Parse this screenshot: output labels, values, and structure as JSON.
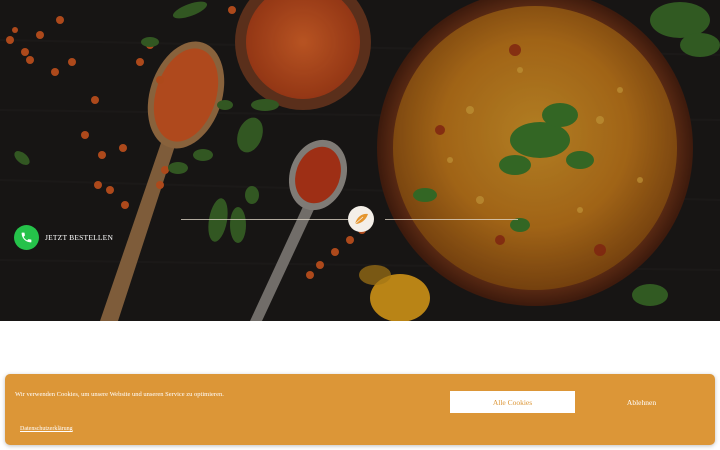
{
  "hero": {
    "image_description": "dark wooden table with lentil soup bowl, red lentils, spices and herbs",
    "emblem_icon": "leaf-emblem-icon"
  },
  "order_button": {
    "label": "JETZT BESTELLEN",
    "icon": "phone-icon",
    "color": "#25c24a"
  },
  "cookie_banner": {
    "message": "Wir verwenden Cookies, um unsere Website und unseren Service zu optimieren.",
    "accept_label": "Alle Cookies",
    "decline_label": "Ablehnen",
    "privacy_link": "Datenschutzerklärung",
    "background_color": "#dc9637"
  }
}
